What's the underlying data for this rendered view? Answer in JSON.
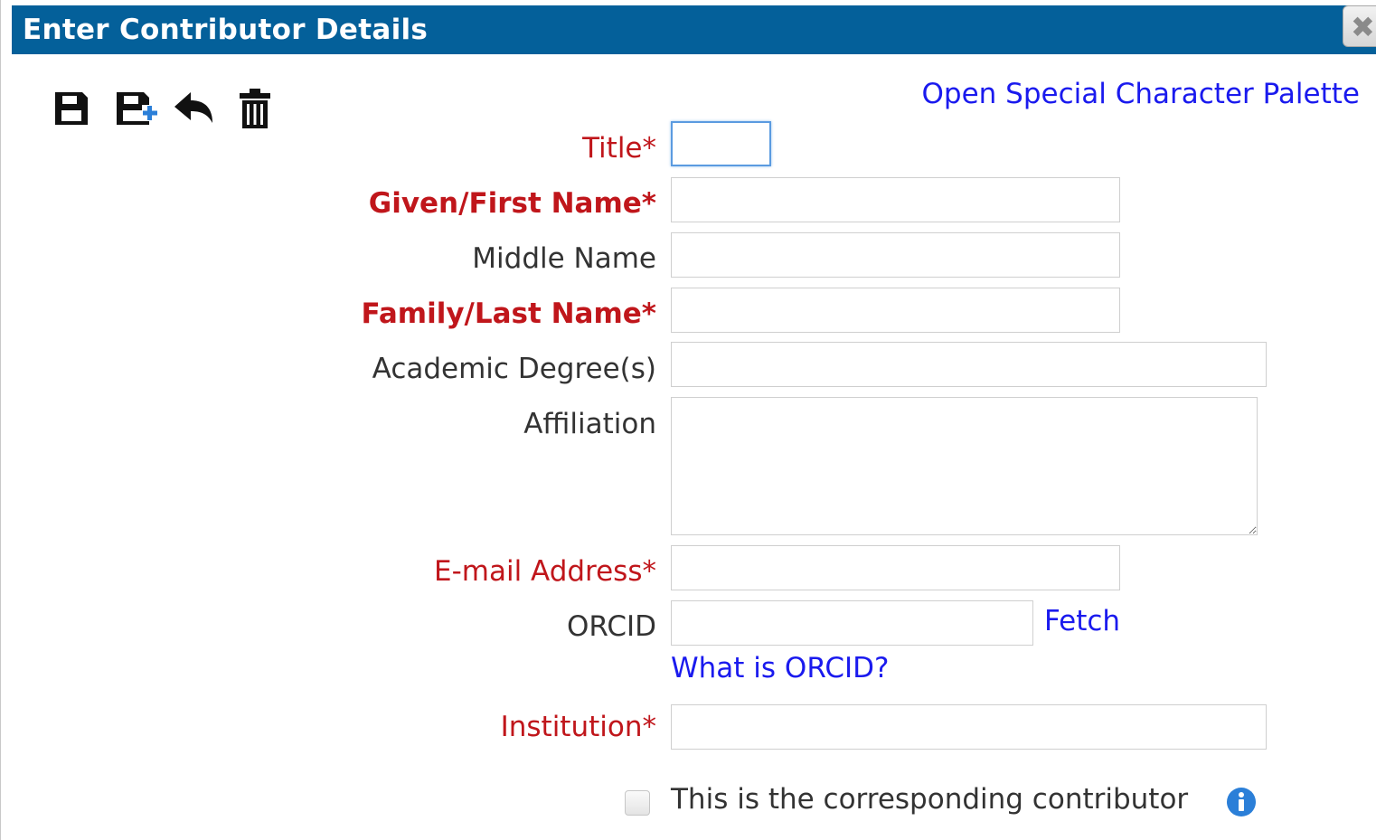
{
  "dialog": {
    "title": "Enter Contributor Details",
    "close_glyph": "✖"
  },
  "toolbar": {
    "icons": [
      "save-icon",
      "save-and-add-icon",
      "undo-icon",
      "trash-icon"
    ]
  },
  "palette_link": "Open Special Character Palette",
  "fields": {
    "title": {
      "label": "Title*",
      "value": ""
    },
    "given_name": {
      "label": "Given/First Name*",
      "value": ""
    },
    "middle_name": {
      "label": "Middle Name",
      "value": ""
    },
    "family_name": {
      "label": "Family/Last Name*",
      "value": ""
    },
    "academic_degrees": {
      "label": "Academic Degree(s)",
      "value": ""
    },
    "affiliation": {
      "label": "Affiliation",
      "value": ""
    },
    "email": {
      "label": "E-mail Address*",
      "value": ""
    },
    "orcid": {
      "label": "ORCID",
      "value": ""
    },
    "institution": {
      "label": "Institution*",
      "value": ""
    }
  },
  "fetch_link": "Fetch",
  "what_is_orcid_link": "What is ORCID?",
  "corresponding": {
    "label": "This is the corresponding contributor",
    "checked": false
  },
  "colors": {
    "titlebar": "#04609a",
    "required": "#c0161b",
    "link": "#1a1aee",
    "info": "#2b7fd8"
  }
}
